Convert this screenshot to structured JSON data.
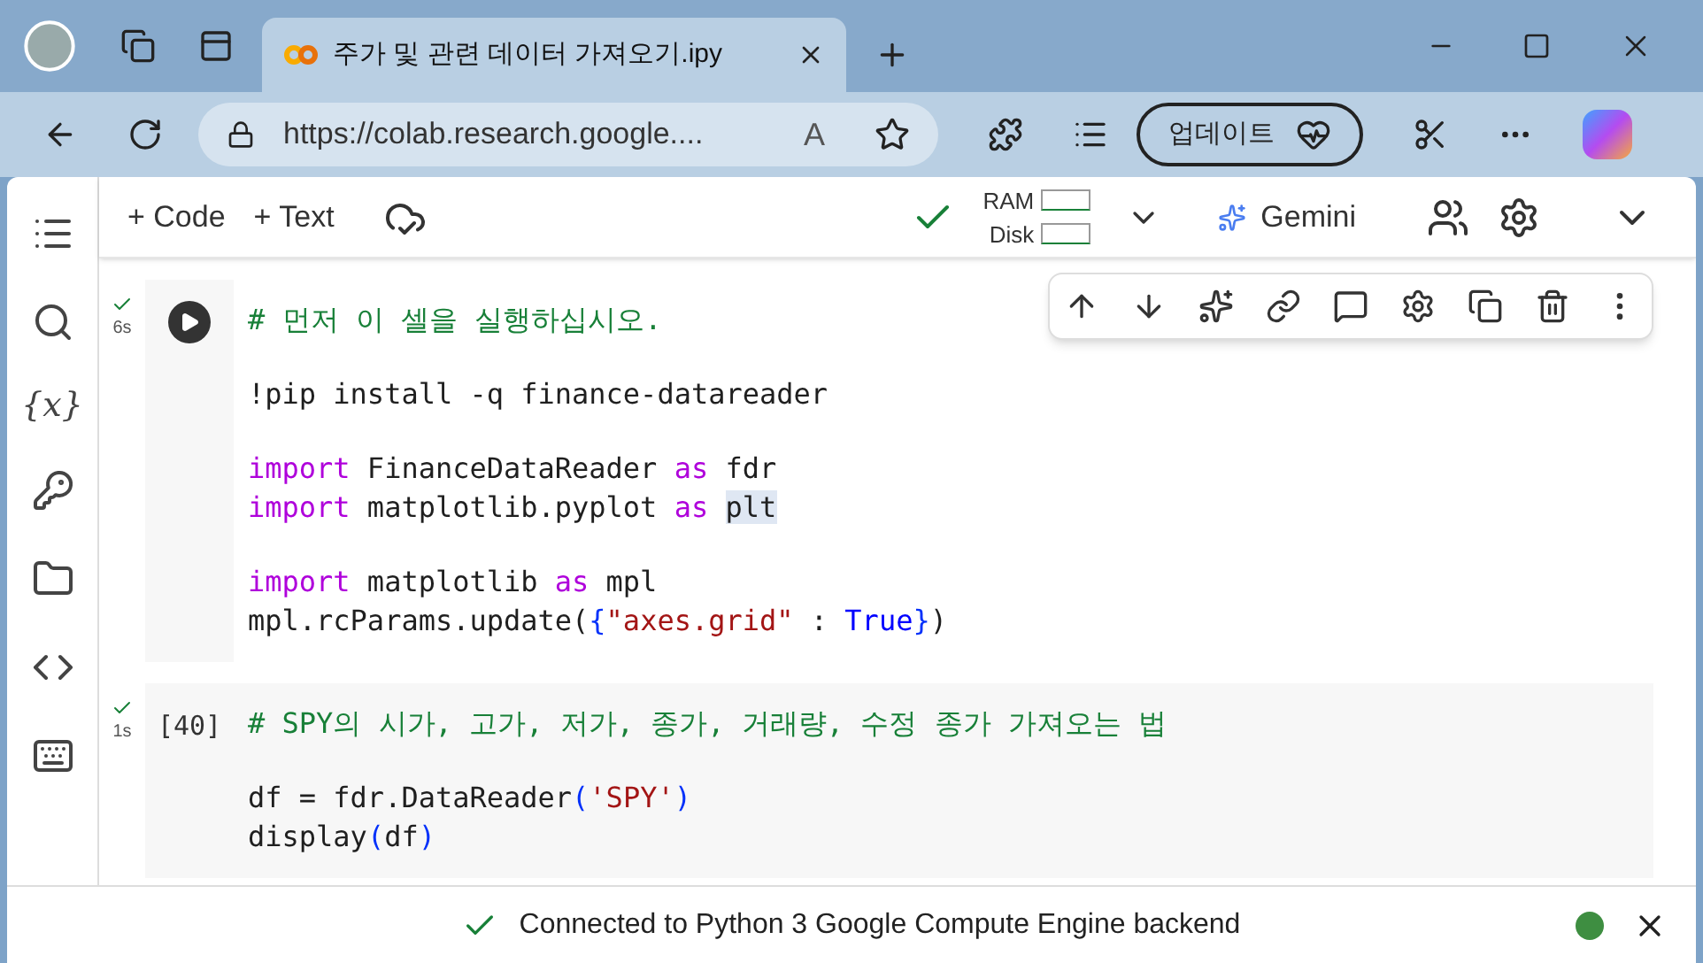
{
  "browser": {
    "tab": {
      "title": "주가 및 관련 데이터 가져오기.ipy"
    },
    "url": "https://colab.research.google....",
    "read_aloud": "A",
    "update_button": "업데이트"
  },
  "sidebar": {
    "items": [
      {
        "kind": "list"
      },
      {
        "kind": "search"
      },
      {
        "kind": "text",
        "label": "{x}"
      },
      {
        "kind": "key"
      },
      {
        "kind": "folder"
      },
      {
        "kind": "code"
      },
      {
        "kind": "terminal"
      }
    ]
  },
  "toolbar": {
    "add_code": "+ Code",
    "add_text": "+ Text",
    "ram": "RAM",
    "disk": "Disk",
    "gemini": "Gemini"
  },
  "cells": [
    {
      "time": "6s",
      "running_button": true,
      "lines": [
        {
          "kind": "code",
          "tokens": [
            {
              "kind": "comment",
              "text": "# 먼저 이 셀을 실행하십시오."
            }
          ]
        },
        {
          "kind": "blank"
        },
        {
          "kind": "code",
          "tokens": [
            {
              "kind": "plain",
              "text": "!pip install -q finance-datareader"
            }
          ]
        },
        {
          "kind": "blank"
        },
        {
          "kind": "code",
          "tokens": [
            {
              "kind": "keyword",
              "text": "import"
            },
            {
              "kind": "plain",
              "text": " FinanceDataReader "
            },
            {
              "kind": "keyword",
              "text": "as"
            },
            {
              "kind": "plain",
              "text": " fdr"
            }
          ]
        },
        {
          "kind": "code",
          "tokens": [
            {
              "kind": "keyword",
              "text": "import"
            },
            {
              "kind": "plain",
              "text": " matplotlib.pyplot "
            },
            {
              "kind": "keyword",
              "text": "as"
            },
            {
              "kind": "highlight",
              "text": "plt"
            }
          ]
        },
        {
          "kind": "blank"
        },
        {
          "kind": "code",
          "tokens": [
            {
              "kind": "keyword",
              "text": "import"
            },
            {
              "kind": "plain",
              "text": " matplotlib "
            },
            {
              "kind": "keyword",
              "text": "as"
            },
            {
              "kind": "plain",
              "text": " mpl"
            }
          ]
        },
        {
          "kind": "code",
          "tokens": [
            {
              "kind": "plain",
              "text": "mpl.rcParams.update("
            },
            {
              "kind": "brace",
              "text": "{"
            },
            {
              "kind": "string",
              "text": "\"axes.grid\""
            },
            {
              "kind": "plain",
              "text": " : "
            },
            {
              "kind": "constant",
              "text": "True"
            },
            {
              "kind": "brace",
              "text": "}"
            },
            {
              "kind": "plain",
              "text": ")"
            }
          ]
        }
      ]
    },
    {
      "time": "1s",
      "count": "[40]",
      "running_button": false,
      "lines": [
        {
          "kind": "code",
          "tokens": [
            {
              "kind": "comment",
              "text": "# SPY의 시가, 고가, 저가, 종가, 거래량, 수정 종가 가져오는 법"
            }
          ]
        },
        {
          "kind": "blank"
        },
        {
          "kind": "code",
          "tokens": [
            {
              "kind": "plain",
              "text": "df = fdr.DataReader"
            },
            {
              "kind": "brace",
              "text": "("
            },
            {
              "kind": "string",
              "text": "'SPY'"
            },
            {
              "kind": "brace",
              "text": ")"
            }
          ]
        },
        {
          "kind": "code",
          "tokens": [
            {
              "kind": "plain",
              "text": "display"
            },
            {
              "kind": "brace",
              "text": "("
            },
            {
              "kind": "plain",
              "text": "df"
            },
            {
              "kind": "brace",
              "text": ")"
            }
          ]
        }
      ]
    }
  ],
  "status_bar": {
    "text": "Connected to Python 3 Google Compute Engine backend"
  }
}
